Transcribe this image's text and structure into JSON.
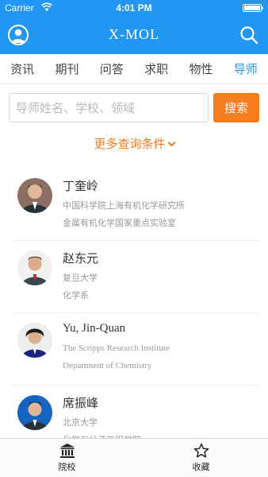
{
  "status_bar": {
    "carrier": "Carrier",
    "time": "4:01 PM"
  },
  "nav": {
    "title": "X-MOL",
    "user_icon": "user-circle-icon",
    "search_icon": "search-icon"
  },
  "tabs": [
    {
      "label": "资讯",
      "active": false
    },
    {
      "label": "期刊",
      "active": false
    },
    {
      "label": "问答",
      "active": false
    },
    {
      "label": "求职",
      "active": false
    },
    {
      "label": "物性",
      "active": false
    },
    {
      "label": "导师",
      "active": true
    }
  ],
  "search": {
    "placeholder": "导师姓名、学校、领域",
    "value": "",
    "button_label": "搜索"
  },
  "more_conditions": {
    "label": "更多查询条件"
  },
  "advisors": [
    {
      "name": "丁奎岭",
      "line1": "中国科学院上海有机化学研究所",
      "line2": "金属有机化学国家重点实验室"
    },
    {
      "name": "赵东元",
      "line1": "复旦大学",
      "line2": "化学系"
    },
    {
      "name": "Yu, Jin-Quan",
      "line1": "The Scripps Research Institute",
      "line2": "Department of Chemistry"
    },
    {
      "name": "席振峰",
      "line1": "北京大学",
      "line2": "化学与分子工程学院"
    }
  ],
  "bottom_tabs": [
    {
      "label": "院校",
      "icon": "institution-icon"
    },
    {
      "label": "收藏",
      "icon": "star-icon"
    }
  ],
  "colors": {
    "primary": "#2196f3",
    "accent": "#f57c1f"
  }
}
